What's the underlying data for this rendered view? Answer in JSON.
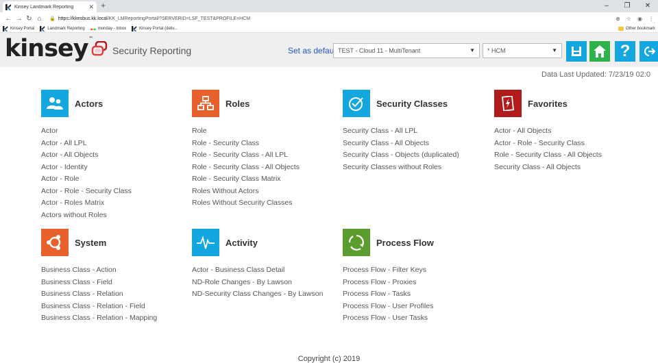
{
  "browser": {
    "tab_title": "Kinsey Landmark Reporting",
    "new_tab": "+",
    "url_host": "https://kkesbus.kk.local",
    "url_path": "/KK_LMReportingPortal/?SERVERID=LSF_TEST&PROFILE=HCM",
    "bookmarks": [
      "Kinsey Portal",
      "Landmark Reporting",
      "monday - Inbox",
      "Kinsey Portal (deliv..."
    ],
    "other_bookmarks": "Other bookmark"
  },
  "header": {
    "logo_text": "kinsey",
    "logo_mark": "™",
    "app_title": "Security Reporting",
    "set_default_label": "Set as default",
    "environment": "TEST - Cloud 11 - MultiTenant",
    "profile": "* HCM",
    "help_label": "?",
    "accent_color": "#14a6df",
    "home_color": "#2db34a"
  },
  "data_last_updated": "Data Last Updated: 7/23/19 02:0",
  "categories": [
    {
      "title": "Actors",
      "icon": "users-icon",
      "color": "#14a6df",
      "items": [
        "Actor",
        "Actor - All LPL",
        "Actor - All Objects",
        "Actor - Identity",
        "Actor - Role",
        "Actor - Role - Security Class",
        "Actor - Roles Matrix",
        "Actors without Roles"
      ]
    },
    {
      "title": "Roles",
      "icon": "hierarchy-icon",
      "color": "#e8612c",
      "items": [
        "Role",
        "Role - Security Class",
        "Role - Security Class - All LPL",
        "Role - Security Class - All Objects",
        "Role - Security Class Matrix",
        "Roles Without Actors",
        "Roles Without Security Classes"
      ]
    },
    {
      "title": "Security Classes",
      "icon": "check-circle-icon",
      "color": "#14a6df",
      "items": [
        "Security Class - All LPL",
        "Security Class - All Objects",
        "Security Class - Objects (duplicated)",
        "Security Classes without Roles"
      ]
    },
    {
      "title": "Favorites",
      "icon": "favorite-card-icon",
      "color": "#b01c1c",
      "items": [
        "Actor - All Objects",
        "Actor - Role - Security Class",
        "Role - Security Class - All Objects",
        "Security Class - All Objects"
      ]
    },
    {
      "title": "System",
      "icon": "system-icon",
      "color": "#e8612c",
      "items": [
        "Business Class - Action",
        "Business Class - Field",
        "Business Class - Relation",
        "Business Class - Relation - Field",
        "Business Class - Relation - Mapping"
      ]
    },
    {
      "title": "Activity",
      "icon": "pulse-icon",
      "color": "#14a6df",
      "items": [
        "Actor - Business Class Detail",
        "ND-Role Changes - By Lawson",
        "ND-Security Class Changes - By Lawson"
      ]
    },
    {
      "title": "Process Flow",
      "icon": "cycle-icon",
      "color": "#5b9c2e",
      "items": [
        "Process Flow - Filter Keys",
        "Process Flow - Proxies",
        "Process Flow - Tasks",
        "Process Flow - User Profiles",
        "Process Flow - User Tasks"
      ]
    }
  ],
  "footer": "Copyright (c) 2019"
}
